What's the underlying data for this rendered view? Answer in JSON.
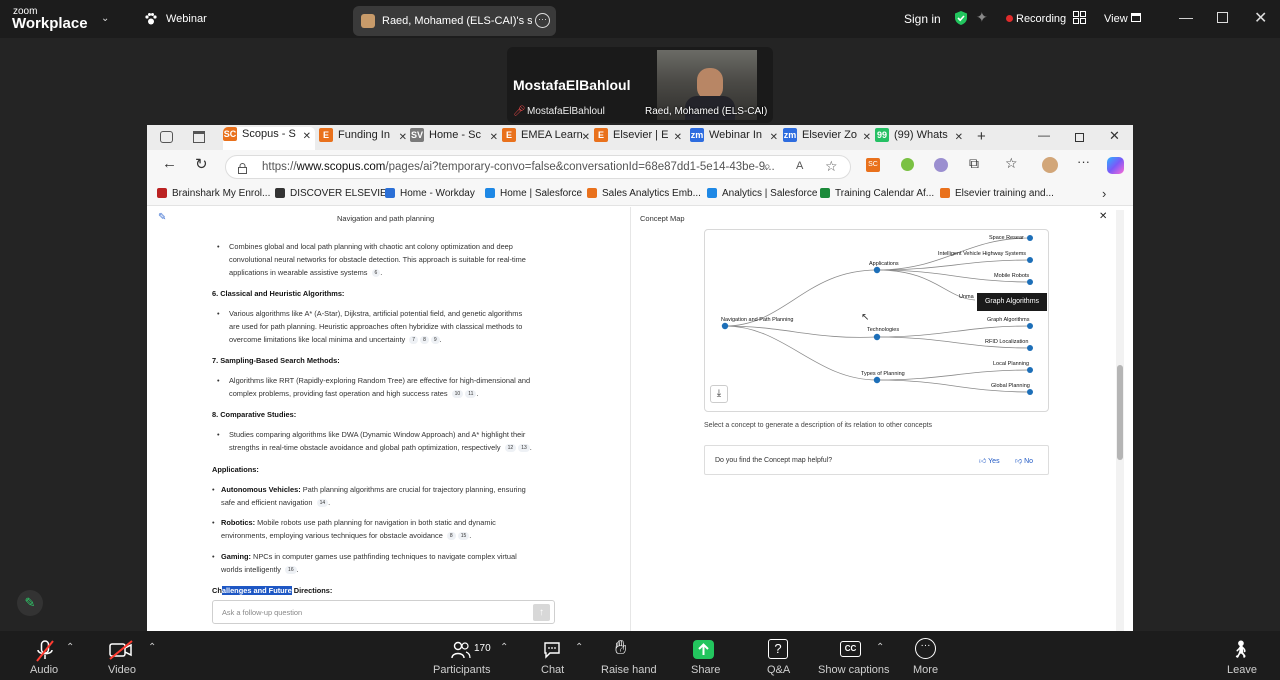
{
  "zoom": {
    "logo_top": "zoom",
    "logo_bottom": "Workplace",
    "webinar_label": "Webinar",
    "share_tab_label": "Raed, Mohamed (ELS-CAI)'s scree",
    "sign_in": "Sign in",
    "recording": "Recording",
    "view": "View",
    "speaker_name": "MostafaElBahloul",
    "speaker_sub": "MostafaElBahloul",
    "video_name": "Raed, Mohamed (ELS-CAI)",
    "recording_color": "#e02b2b",
    "share_color": "#23c55e"
  },
  "browser": {
    "tabs": [
      {
        "icon": "SC",
        "label": "Scopus - S",
        "color": "#e9711c"
      },
      {
        "icon": "E",
        "label": "Funding In",
        "color": "#e9711c"
      },
      {
        "icon": "SV",
        "label": "Home - Sc",
        "color": "#7a7a7a"
      },
      {
        "icon": "E",
        "label": "EMEA Learn",
        "color": "#e9711c"
      },
      {
        "icon": "E",
        "label": "Elsevier | E",
        "color": "#e9711c"
      },
      {
        "icon": "zm",
        "label": "Webinar In",
        "color": "#2d6cdf"
      },
      {
        "icon": "zm",
        "label": "Elsevier Zo",
        "color": "#2d6cdf"
      },
      {
        "icon": "99",
        "label": "(99) Whats",
        "color": "#25c064"
      }
    ],
    "url_prefix": "https://",
    "url_domain": "www.scopus.com",
    "url_rest": "/pages/ai?temporary-convo=false&conversationId=68e87dd1-5e14-43be-9...",
    "bookmarks": [
      "Brainshark My Enrol...",
      "DISCOVER ELSEVIER",
      "Home - Workday",
      "Home | Salesforce",
      "Sales Analytics Emb...",
      "Analytics | Salesforce",
      "Training Calendar Af...",
      "Elsevier training and..."
    ]
  },
  "left_panel": {
    "title": "Navigation and path planning",
    "lines": [
      "Combines global and local path planning with chaotic ant colony optimization and deep",
      "convolutional neural networks for obstacle detection. This approach is suitable for real-time",
      "applications in wearable assistive systems"
    ],
    "cite_a": "6",
    "h6": "6. Classical and Heuristic Algorithms:",
    "l6": [
      "Various algorithms like A* (A-Star), Dijkstra, artificial potential field, and genetic algorithms",
      "are used for path planning. Heuristic approaches often hybridize with classical methods to",
      "overcome limitations like local minima and uncertainty"
    ],
    "cites6": [
      "7",
      "8",
      "9"
    ],
    "h7": "7. Sampling-Based Search Methods:",
    "l7": [
      "Algorithms like RRT (Rapidly-exploring Random Tree) are effective for high-dimensional and",
      "complex problems, providing fast operation and high success rates"
    ],
    "cites7": [
      "10",
      "11"
    ],
    "h8": "8. Comparative Studies:",
    "l8": [
      "Studies comparing algorithms like DWA (Dynamic Window Approach) and A* highlight their",
      "strengths in real-time obstacle avoidance and global path optimization, respectively"
    ],
    "cites8": [
      "12",
      "13"
    ],
    "apps_heading": "Applications:",
    "app1_bold": "Autonomous Vehicles:",
    "app1": [
      " Path planning algorithms are crucial for trajectory planning, ensuring",
      "safe and efficient navigation"
    ],
    "cite_app1": "14",
    "app2_bold": "Robotics:",
    "app2": [
      " Mobile robots use path planning for navigation in both static and dynamic",
      "environments, employing various techniques for obstacle avoidance"
    ],
    "cites_app2": [
      "8",
      "15"
    ],
    "app3_bold": "Gaming:",
    "app3": [
      " NPCs in computer games use pathfinding techniques to navigate complex virtual",
      "worlds intelligently"
    ],
    "cite_app3": "16",
    "challenges_pre": "Ch",
    "challenges_sel": "allenges and Future",
    "challenges_post": " Directions:",
    "followup_placeholder": "Ask a follow-up question"
  },
  "concept_map": {
    "title": "Concept Map",
    "root": "Navigation and Path Planning",
    "branches": [
      "Applications",
      "Technologies",
      "Types of Planning"
    ],
    "leaves": [
      "Space Resear",
      "Intelligent Vehicle Highway Systems",
      "Mobile Robots",
      "Unma",
      "Graph Algorithms",
      "RFID Localization",
      "Local Planning",
      "Global Planning"
    ],
    "tooltip": "Graph Algorithms",
    "hint": "Select a concept to generate a description of its relation to other concepts",
    "feedback_q": "Do you find the Concept map helpful?",
    "yes": "Yes",
    "no": "No"
  },
  "controls": {
    "audio": "Audio",
    "video": "Video",
    "participants": "Participants",
    "participant_count": "170",
    "chat": "Chat",
    "raise_hand": "Raise hand",
    "share": "Share",
    "qa": "Q&A",
    "captions": "Show captions",
    "more": "More",
    "leave": "Leave"
  }
}
